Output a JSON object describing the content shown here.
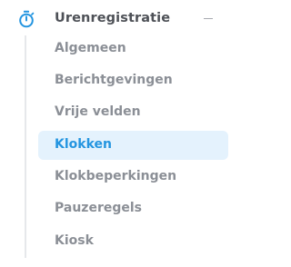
{
  "nav": {
    "header": {
      "label": "Urenregistratie",
      "icon": "stopwatch-icon",
      "toggle_icon": "collapse-minus-icon",
      "accent_color": "#2495e0"
    },
    "items": [
      {
        "label": "Algemeen",
        "active": false
      },
      {
        "label": "Berichtgevingen",
        "active": false
      },
      {
        "label": "Vrije velden",
        "active": false
      },
      {
        "label": "Klokken",
        "active": true
      },
      {
        "label": "Klokbeperkingen",
        "active": false
      },
      {
        "label": "Pauzeregels",
        "active": false
      },
      {
        "label": "Kiosk",
        "active": false
      }
    ]
  }
}
